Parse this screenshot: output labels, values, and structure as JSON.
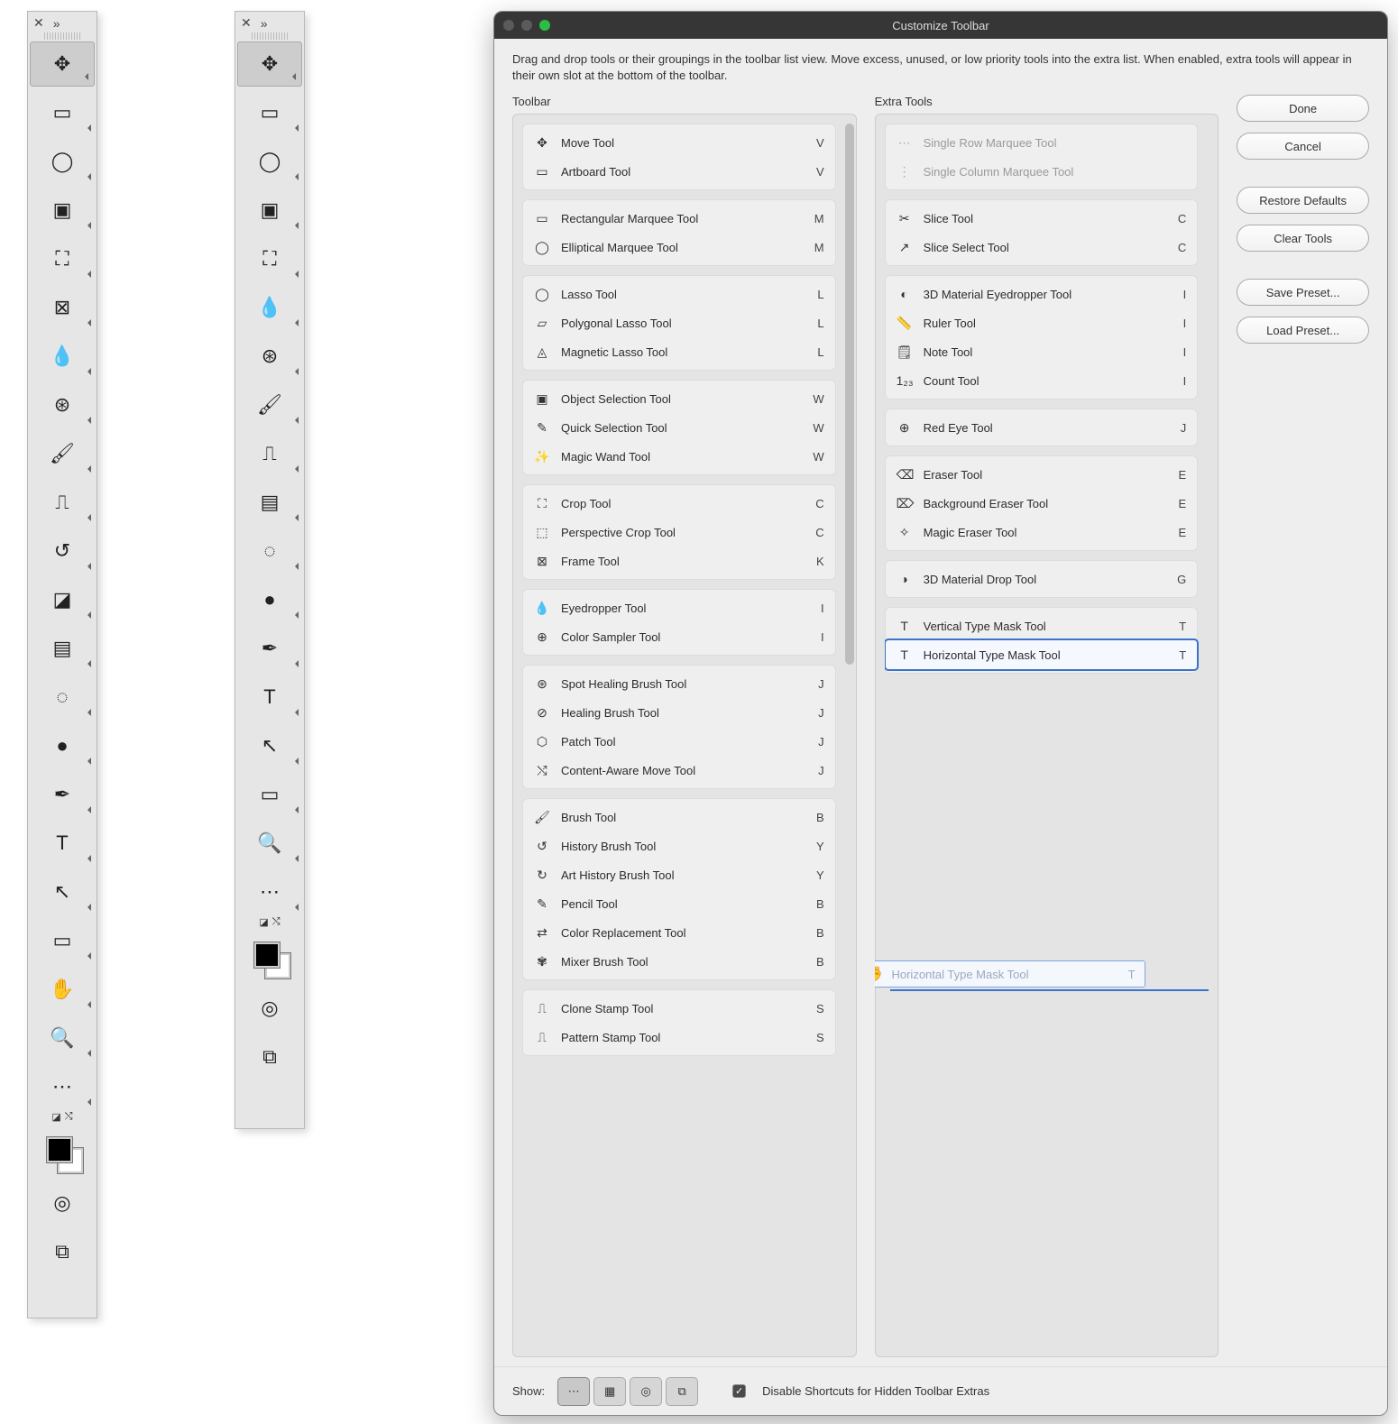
{
  "dialog": {
    "title": "Customize Toolbar",
    "description": "Drag and drop tools or their groupings in the toolbar list view. Move excess, unused, or low priority tools into the extra list. When enabled, extra tools will appear in their own slot at the bottom of the toolbar.",
    "toolbar_header": "Toolbar",
    "extra_header": "Extra Tools",
    "buttons": {
      "done": "Done",
      "cancel": "Cancel",
      "restore": "Restore Defaults",
      "clear": "Clear Tools",
      "save": "Save Preset...",
      "load": "Load Preset..."
    },
    "bottom": {
      "show_label": "Show:",
      "disable_label": "Disable Shortcuts for Hidden Toolbar Extras",
      "segs": [
        "⋯",
        "▦",
        "◎",
        "⧉"
      ]
    },
    "toolbar_groups": [
      [
        {
          "name": "Move Tool",
          "key": "V",
          "icon": "✥"
        },
        {
          "name": "Artboard Tool",
          "key": "V",
          "icon": "▭"
        }
      ],
      [
        {
          "name": "Rectangular Marquee Tool",
          "key": "M",
          "icon": "▭"
        },
        {
          "name": "Elliptical Marquee Tool",
          "key": "M",
          "icon": "◯"
        }
      ],
      [
        {
          "name": "Lasso Tool",
          "key": "L",
          "icon": "◯"
        },
        {
          "name": "Polygonal Lasso Tool",
          "key": "L",
          "icon": "▱"
        },
        {
          "name": "Magnetic Lasso Tool",
          "key": "L",
          "icon": "◬"
        }
      ],
      [
        {
          "name": "Object Selection Tool",
          "key": "W",
          "icon": "▣"
        },
        {
          "name": "Quick Selection Tool",
          "key": "W",
          "icon": "✎"
        },
        {
          "name": "Magic Wand Tool",
          "key": "W",
          "icon": "✨"
        }
      ],
      [
        {
          "name": "Crop Tool",
          "key": "C",
          "icon": "⛶"
        },
        {
          "name": "Perspective Crop Tool",
          "key": "C",
          "icon": "⬚"
        },
        {
          "name": "Frame Tool",
          "key": "K",
          "icon": "⊠"
        }
      ],
      [
        {
          "name": "Eyedropper Tool",
          "key": "I",
          "icon": "💧"
        },
        {
          "name": "Color Sampler Tool",
          "key": "I",
          "icon": "⊕"
        }
      ],
      [
        {
          "name": "Spot Healing Brush Tool",
          "key": "J",
          "icon": "⊛"
        },
        {
          "name": "Healing Brush Tool",
          "key": "J",
          "icon": "⊘"
        },
        {
          "name": "Patch Tool",
          "key": "J",
          "icon": "⬡"
        },
        {
          "name": "Content-Aware Move Tool",
          "key": "J",
          "icon": "⤭"
        }
      ],
      [
        {
          "name": "Brush Tool",
          "key": "B",
          "icon": "🖌"
        },
        {
          "name": "History Brush Tool",
          "key": "Y",
          "icon": "↺"
        },
        {
          "name": "Art History Brush Tool",
          "key": "Y",
          "icon": "↻"
        },
        {
          "name": "Pencil Tool",
          "key": "B",
          "icon": "✎"
        },
        {
          "name": "Color Replacement Tool",
          "key": "B",
          "icon": "⇄"
        },
        {
          "name": "Mixer Brush Tool",
          "key": "B",
          "icon": "✾"
        }
      ],
      [
        {
          "name": "Clone Stamp Tool",
          "key": "S",
          "icon": "⎍"
        },
        {
          "name": "Pattern Stamp Tool",
          "key": "S",
          "icon": "⎍"
        }
      ]
    ],
    "drag_ghost": {
      "name": "Horizontal Type Mask Tool",
      "key": "T",
      "icon": "T"
    },
    "extra_groups": [
      [
        {
          "name": "Single Row Marquee Tool",
          "key": "",
          "icon": "⋯",
          "disabled": true
        },
        {
          "name": "Single Column Marquee Tool",
          "key": "",
          "icon": "⋮",
          "disabled": true
        }
      ],
      [
        {
          "name": "Slice Tool",
          "key": "C",
          "icon": "✂"
        },
        {
          "name": "Slice Select Tool",
          "key": "C",
          "icon": "↗"
        }
      ],
      [
        {
          "name": "3D Material Eyedropper Tool",
          "key": "I",
          "icon": "◐"
        },
        {
          "name": "Ruler Tool",
          "key": "I",
          "icon": "📏"
        },
        {
          "name": "Note Tool",
          "key": "I",
          "icon": "🗒"
        },
        {
          "name": "Count Tool",
          "key": "I",
          "icon": "1₂₃"
        }
      ],
      [
        {
          "name": "Red Eye Tool",
          "key": "J",
          "icon": "⊕"
        }
      ],
      [
        {
          "name": "Eraser Tool",
          "key": "E",
          "icon": "⌫"
        },
        {
          "name": "Background Eraser Tool",
          "key": "E",
          "icon": "⌦"
        },
        {
          "name": "Magic Eraser Tool",
          "key": "E",
          "icon": "✧"
        }
      ],
      [
        {
          "name": "3D Material Drop Tool",
          "key": "G",
          "icon": "◑"
        }
      ],
      [
        {
          "name": "Vertical Type Mask Tool",
          "key": "T",
          "icon": "T"
        },
        {
          "name": "Horizontal Type Mask Tool",
          "key": "T",
          "icon": "T",
          "selected": true
        }
      ]
    ]
  },
  "palettes": {
    "left": [
      "move",
      "marquee",
      "lasso",
      "quick-select",
      "crop",
      "frame",
      "eyedropper",
      "heal",
      "brush",
      "stamp",
      "history",
      "eraser",
      "gradient",
      "blur",
      "dodge",
      "pen",
      "type",
      "path",
      "rectangle",
      "hand",
      "zoom",
      "more"
    ],
    "right": [
      "move",
      "marquee",
      "lasso",
      "quick-select",
      "crop",
      "eyedropper",
      "heal",
      "brush",
      "stamp",
      "gradient",
      "blur",
      "dodge",
      "pen",
      "type",
      "path",
      "rectangle",
      "zoom",
      "more"
    ],
    "icons": {
      "move": "✥",
      "marquee": "▭",
      "lasso": "◯",
      "quick-select": "▣",
      "crop": "⛶",
      "frame": "⊠",
      "eyedropper": "💧",
      "heal": "⊛",
      "brush": "🖌",
      "stamp": "⎍",
      "history": "↺",
      "eraser": "◪",
      "gradient": "▤",
      "blur": "◌",
      "dodge": "●",
      "pen": "✒",
      "type": "T",
      "path": "↖",
      "rectangle": "▭",
      "hand": "✋",
      "zoom": "🔍",
      "more": "⋯"
    }
  }
}
